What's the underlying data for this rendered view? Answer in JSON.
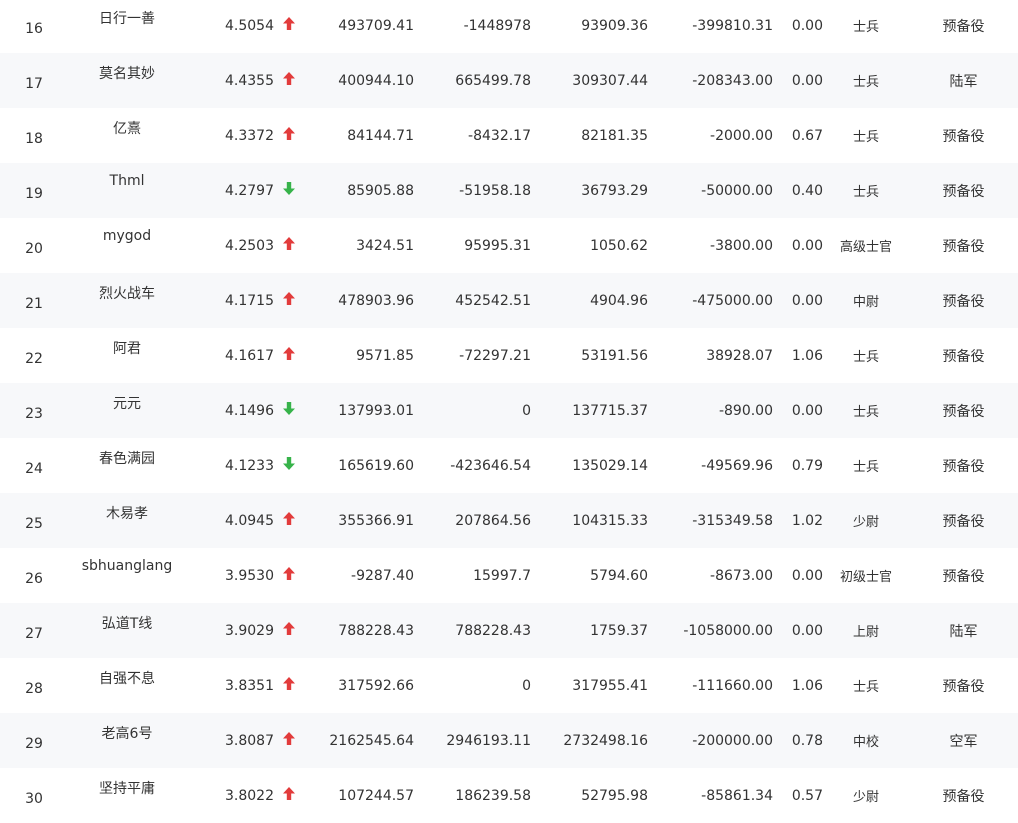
{
  "colors": {
    "up": "#e23b3b",
    "down": "#37b34a",
    "text": "#333333",
    "row_alt": "#f7f8fa"
  },
  "rows": [
    {
      "rank": "16",
      "name": "日行一善",
      "score": "4.5054",
      "trend": "up",
      "v1": "493709.41",
      "v2": "-1448978",
      "v3": "93909.36",
      "v4": "-399810.31",
      "rate": "0.00",
      "title": "士兵",
      "branch": "预备役"
    },
    {
      "rank": "17",
      "name": "莫名其妙",
      "score": "4.4355",
      "trend": "up",
      "v1": "400944.10",
      "v2": "665499.78",
      "v3": "309307.44",
      "v4": "-208343.00",
      "rate": "0.00",
      "title": "士兵",
      "branch": "陆军"
    },
    {
      "rank": "18",
      "name": "亿熹",
      "score": "4.3372",
      "trend": "up",
      "v1": "84144.71",
      "v2": "-8432.17",
      "v3": "82181.35",
      "v4": "-2000.00",
      "rate": "0.67",
      "title": "士兵",
      "branch": "预备役"
    },
    {
      "rank": "19",
      "name": "Thml",
      "score": "4.2797",
      "trend": "down",
      "v1": "85905.88",
      "v2": "-51958.18",
      "v3": "36793.29",
      "v4": "-50000.00",
      "rate": "0.40",
      "title": "士兵",
      "branch": "预备役"
    },
    {
      "rank": "20",
      "name": "mygod",
      "score": "4.2503",
      "trend": "up",
      "v1": "3424.51",
      "v2": "95995.31",
      "v3": "1050.62",
      "v4": "-3800.00",
      "rate": "0.00",
      "title": "高级士官",
      "branch": "预备役"
    },
    {
      "rank": "21",
      "name": "烈火战车",
      "score": "4.1715",
      "trend": "up",
      "v1": "478903.96",
      "v2": "452542.51",
      "v3": "4904.96",
      "v4": "-475000.00",
      "rate": "0.00",
      "title": "中尉",
      "branch": "预备役"
    },
    {
      "rank": "22",
      "name": "阿君",
      "score": "4.1617",
      "trend": "up",
      "v1": "9571.85",
      "v2": "-72297.21",
      "v3": "53191.56",
      "v4": "38928.07",
      "rate": "1.06",
      "title": "士兵",
      "branch": "预备役"
    },
    {
      "rank": "23",
      "name": "元元",
      "score": "4.1496",
      "trend": "down",
      "v1": "137993.01",
      "v2": "0",
      "v3": "137715.37",
      "v4": "-890.00",
      "rate": "0.00",
      "title": "士兵",
      "branch": "预备役"
    },
    {
      "rank": "24",
      "name": "春色满园",
      "score": "4.1233",
      "trend": "down",
      "v1": "165619.60",
      "v2": "-423646.54",
      "v3": "135029.14",
      "v4": "-49569.96",
      "rate": "0.79",
      "title": "士兵",
      "branch": "预备役"
    },
    {
      "rank": "25",
      "name": "木易孝",
      "score": "4.0945",
      "trend": "up",
      "v1": "355366.91",
      "v2": "207864.56",
      "v3": "104315.33",
      "v4": "-315349.58",
      "rate": "1.02",
      "title": "少尉",
      "branch": "预备役"
    },
    {
      "rank": "26",
      "name": "sbhuanglang",
      "score": "3.9530",
      "trend": "up",
      "v1": "-9287.40",
      "v2": "15997.7",
      "v3": "5794.60",
      "v4": "-8673.00",
      "rate": "0.00",
      "title": "初级士官",
      "branch": "预备役"
    },
    {
      "rank": "27",
      "name": "弘道T线",
      "score": "3.9029",
      "trend": "up",
      "v1": "788228.43",
      "v2": "788228.43",
      "v3": "1759.37",
      "v4": "-1058000.00",
      "rate": "0.00",
      "title": "上尉",
      "branch": "陆军"
    },
    {
      "rank": "28",
      "name": "自强不息",
      "score": "3.8351",
      "trend": "up",
      "v1": "317592.66",
      "v2": "0",
      "v3": "317955.41",
      "v4": "-111660.00",
      "rate": "1.06",
      "title": "士兵",
      "branch": "预备役"
    },
    {
      "rank": "29",
      "name": "老高6号",
      "score": "3.8087",
      "trend": "up",
      "v1": "2162545.64",
      "v2": "2946193.11",
      "v3": "2732498.16",
      "v4": "-200000.00",
      "rate": "0.78",
      "title": "中校",
      "branch": "空军"
    },
    {
      "rank": "30",
      "name": "坚持平庸",
      "score": "3.8022",
      "trend": "up",
      "v1": "107244.57",
      "v2": "186239.58",
      "v3": "52795.98",
      "v4": "-85861.34",
      "rate": "0.57",
      "title": "少尉",
      "branch": "预备役"
    }
  ]
}
